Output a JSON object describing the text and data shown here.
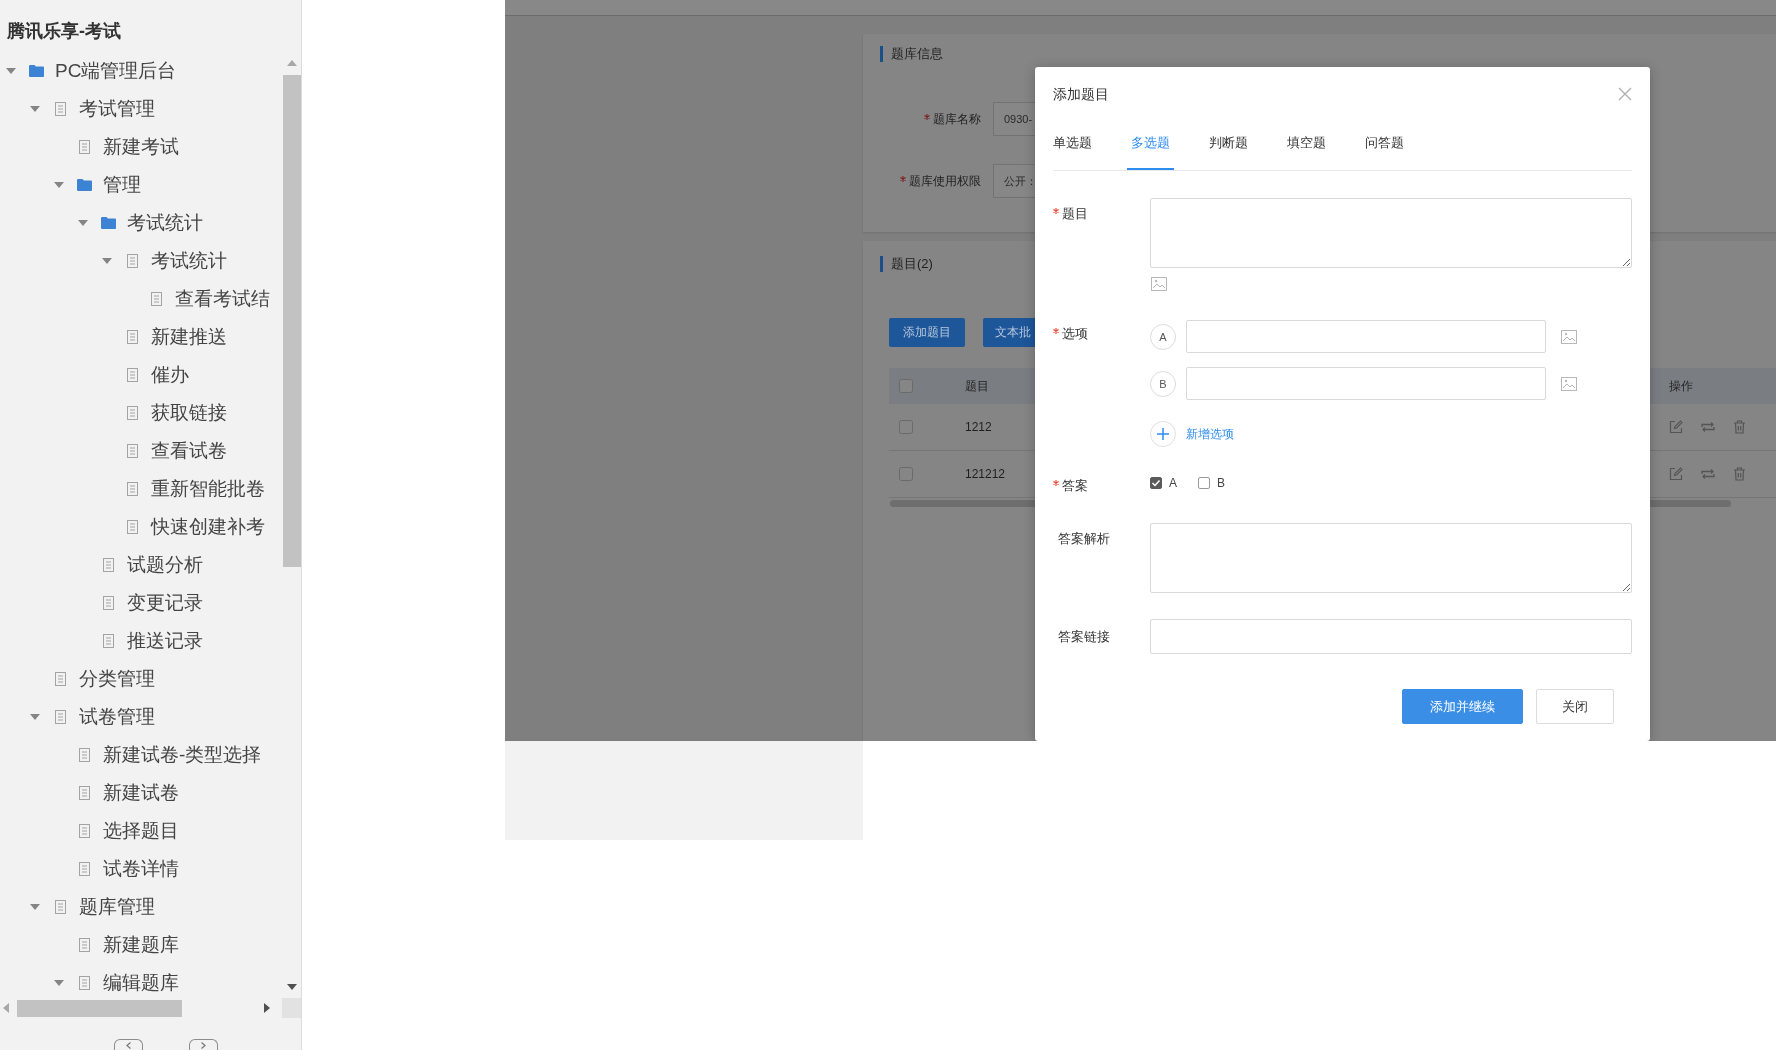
{
  "sidebar": {
    "title": "腾讯乐享-考试",
    "tree": [
      {
        "label": "PC端管理后台",
        "kind": "folder",
        "expanded": true,
        "children": [
          {
            "label": "考试管理",
            "kind": "page",
            "expanded": true,
            "children": [
              {
                "label": "新建考试",
                "kind": "page"
              },
              {
                "label": "管理",
                "kind": "folder",
                "expanded": true,
                "children": [
                  {
                    "label": "考试统计",
                    "kind": "folder",
                    "expanded": true,
                    "children": [
                      {
                        "label": "考试统计",
                        "kind": "page",
                        "expanded": true,
                        "children": [
                          {
                            "label": "查看考试结",
                            "kind": "page"
                          }
                        ]
                      },
                      {
                        "label": "新建推送",
                        "kind": "page"
                      },
                      {
                        "label": "催办",
                        "kind": "page"
                      },
                      {
                        "label": "获取链接",
                        "kind": "page"
                      },
                      {
                        "label": "查看试卷",
                        "kind": "page"
                      },
                      {
                        "label": "重新智能批卷",
                        "kind": "page"
                      },
                      {
                        "label": "快速创建补考",
                        "kind": "page"
                      }
                    ]
                  },
                  {
                    "label": "试题分析",
                    "kind": "page"
                  },
                  {
                    "label": "变更记录",
                    "kind": "page"
                  },
                  {
                    "label": "推送记录",
                    "kind": "page"
                  }
                ]
              }
            ]
          },
          {
            "label": "分类管理",
            "kind": "page"
          },
          {
            "label": "试卷管理",
            "kind": "page",
            "expanded": true,
            "children": [
              {
                "label": "新建试卷-类型选择",
                "kind": "page"
              },
              {
                "label": "新建试卷",
                "kind": "page"
              },
              {
                "label": "选择题目",
                "kind": "page"
              },
              {
                "label": "试卷详情",
                "kind": "page"
              }
            ]
          },
          {
            "label": "题库管理",
            "kind": "page",
            "expanded": true,
            "children": [
              {
                "label": "新建题库",
                "kind": "page"
              },
              {
                "label": "编辑题库",
                "kind": "page",
                "expanded": true
              }
            ]
          }
        ]
      }
    ]
  },
  "page": {
    "info_card": {
      "title": "题库信息",
      "fields": [
        {
          "label": "题库名称",
          "required": true,
          "value": "0930-"
        },
        {
          "label": "题库使用权限",
          "required": true,
          "value": "公开："
        }
      ]
    },
    "questions_card": {
      "title": "题目(2)",
      "buttons": [
        {
          "label": "添加题目"
        },
        {
          "label": "文本批"
        }
      ],
      "table": {
        "header_checked": false,
        "columns": [
          "题目",
          "操作"
        ],
        "rows": [
          {
            "title": "1212",
            "checked": false
          },
          {
            "title": "121212",
            "checked": false
          }
        ]
      }
    }
  },
  "dialog": {
    "title": "添加题目",
    "tabs": [
      {
        "label": "单选题",
        "selected": false
      },
      {
        "label": "多选题",
        "selected": true
      },
      {
        "label": "判断题",
        "selected": false
      },
      {
        "label": "填空题",
        "selected": false
      },
      {
        "label": "问答题",
        "selected": false
      }
    ],
    "question": {
      "label": "题目",
      "required": true
    },
    "options": {
      "label": "选项",
      "required": true,
      "items": [
        {
          "letter": "A"
        },
        {
          "letter": "B"
        }
      ],
      "add_label": "新增选项"
    },
    "answer": {
      "label": "答案",
      "required": true,
      "choices": [
        {
          "label": "A",
          "checked": true
        },
        {
          "label": "B",
          "checked": false
        }
      ]
    },
    "analysis": {
      "label": "答案解析"
    },
    "link": {
      "label": "答案链接"
    },
    "buttons": [
      {
        "label": "添加并继续",
        "kind": "primary"
      },
      {
        "label": "关闭",
        "kind": "default"
      }
    ]
  }
}
